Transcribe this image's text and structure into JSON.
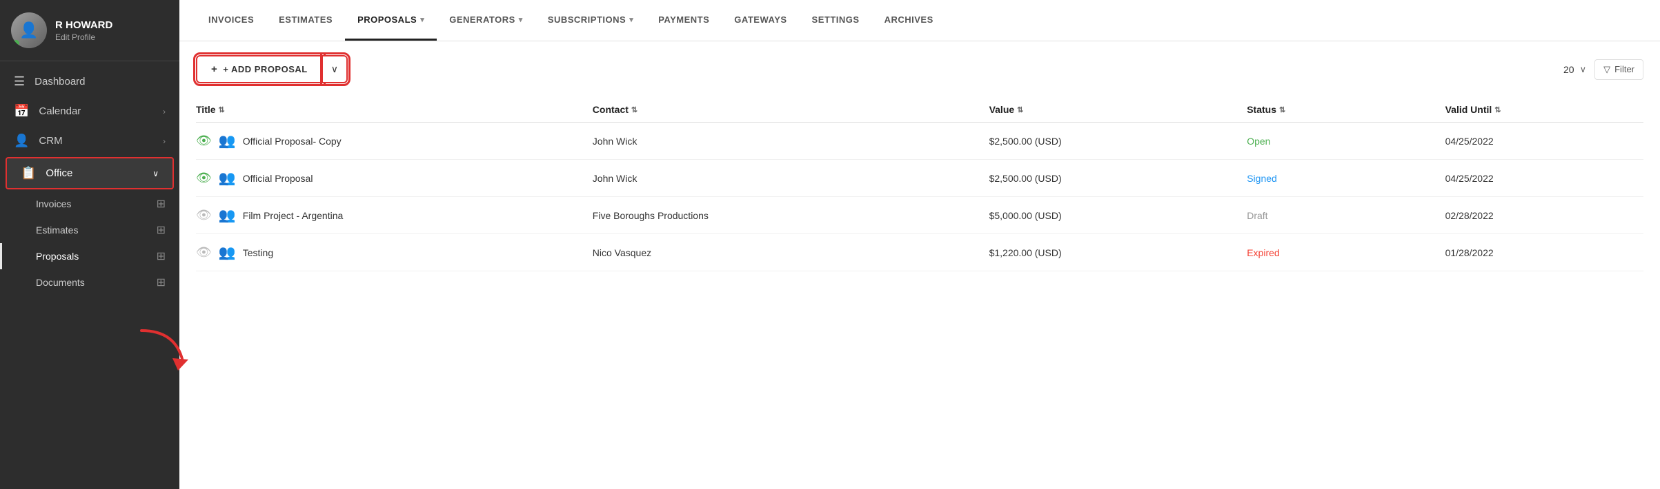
{
  "sidebar": {
    "profile": {
      "name": "R HOWARD",
      "edit_label": "Edit Profile"
    },
    "nav_items": [
      {
        "id": "dashboard",
        "label": "Dashboard",
        "icon": "☰",
        "has_chevron": false
      },
      {
        "id": "calendar",
        "label": "Calendar",
        "icon": "📅",
        "has_chevron": true
      },
      {
        "id": "crm",
        "label": "CRM",
        "icon": "👤",
        "has_chevron": true
      },
      {
        "id": "office",
        "label": "Office",
        "icon": "📋",
        "has_chevron": true,
        "active": true
      }
    ],
    "sub_items": [
      {
        "id": "invoices",
        "label": "Invoices"
      },
      {
        "id": "estimates",
        "label": "Estimates"
      },
      {
        "id": "proposals",
        "label": "Proposals",
        "active": true
      },
      {
        "id": "documents",
        "label": "Documents"
      }
    ]
  },
  "top_nav": {
    "items": [
      {
        "id": "invoices",
        "label": "INVOICES",
        "active": false,
        "has_dropdown": false
      },
      {
        "id": "estimates",
        "label": "ESTIMATES",
        "active": false,
        "has_dropdown": false
      },
      {
        "id": "proposals",
        "label": "PROPOSALS",
        "active": true,
        "has_dropdown": true
      },
      {
        "id": "generators",
        "label": "GENERATORS",
        "active": false,
        "has_dropdown": true
      },
      {
        "id": "subscriptions",
        "label": "SUBSCRIPTIONS",
        "active": false,
        "has_dropdown": true
      },
      {
        "id": "payments",
        "label": "PAYMENTS",
        "active": false,
        "has_dropdown": false
      },
      {
        "id": "gateways",
        "label": "GATEWAYS",
        "active": false,
        "has_dropdown": false
      },
      {
        "id": "settings",
        "label": "SETTINGS",
        "active": false,
        "has_dropdown": false
      },
      {
        "id": "archives",
        "label": "ARCHIVES",
        "active": false,
        "has_dropdown": false
      }
    ]
  },
  "toolbar": {
    "add_proposal_label": "+ ADD PROPOSAL",
    "per_page": "20",
    "filter_label": "Filter"
  },
  "table": {
    "columns": [
      {
        "id": "title",
        "label": "Title"
      },
      {
        "id": "contact",
        "label": "Contact"
      },
      {
        "id": "value",
        "label": "Value"
      },
      {
        "id": "status",
        "label": "Status"
      },
      {
        "id": "valid_until",
        "label": "Valid Until"
      }
    ],
    "rows": [
      {
        "title": "Official Proposal- Copy",
        "contact": "John Wick",
        "value": "$2,500.00 (USD)",
        "status": "Open",
        "status_class": "status-open",
        "valid_until": "04/25/2022",
        "eye_active": true
      },
      {
        "title": "Official Proposal",
        "contact": "John Wick",
        "value": "$2,500.00 (USD)",
        "status": "Signed",
        "status_class": "status-signed",
        "valid_until": "04/25/2022",
        "eye_active": true
      },
      {
        "title": "Film Project - Argentina",
        "contact": "Five Boroughs Productions",
        "value": "$5,000.00 (USD)",
        "status": "Draft",
        "status_class": "status-draft",
        "valid_until": "02/28/2022",
        "eye_active": false
      },
      {
        "title": "Testing",
        "contact": "Nico Vasquez",
        "value": "$1,220.00 (USD)",
        "status": "Expired",
        "status_class": "status-expired",
        "valid_until": "01/28/2022",
        "eye_active": false
      }
    ]
  }
}
